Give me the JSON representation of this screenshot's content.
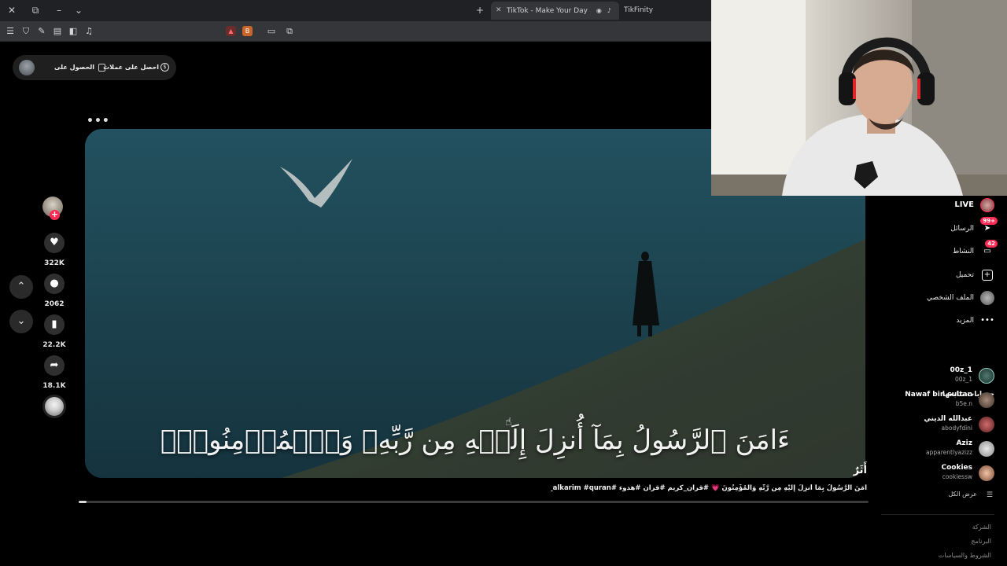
{
  "browser": {
    "tabs": [
      {
        "title": "TikTok - Make Your Day",
        "active": true
      },
      {
        "title": "TikFinity",
        "active": false
      }
    ],
    "new_tab": "+"
  },
  "page": {
    "top_pill": {
      "coins_label": "احصل على عملات",
      "app_label": "الحصول على الت..."
    },
    "more": "•••",
    "video": {
      "verse": "ءَامَنَ ٱلرَّسُولُ بِمَآ أُنزِلَ إِلَيۡهِ مِن رَّبِّهِۦ وَٱلۡمُؤۡمِنُونَۚ"
    },
    "actions": {
      "likes": "322K",
      "comments": "2062",
      "saves": "22.2K",
      "shares": "18.1K"
    },
    "caption": {
      "user": "أَثَرٌ",
      "desc": "آمَنَ الرَّسُولُ بِمَآ أُنزِلَ إِلَيْهِ مِن رَّبِّهِ وَالْمُؤْمِنُونَ 💗 #قران_كريم #قران #هدوء #quran_alkarim #quran",
      "progress": 0.01
    }
  },
  "sidebar": {
    "nav": [
      {
        "label": "LIVE",
        "icon": "live-icon"
      },
      {
        "label": "الرسائل",
        "icon": "messages-icon",
        "badge": "99+"
      },
      {
        "label": "النشاط",
        "icon": "activity-icon",
        "badge": "42"
      },
      {
        "label": "تحميل",
        "icon": "upload-icon"
      },
      {
        "label": "الملف الشخصي",
        "icon": "profile-icon"
      },
      {
        "label": "المزيد",
        "icon": "more-icon"
      }
    ],
    "following_title": "حسابات تتابعها",
    "accounts": [
      {
        "name": "00z_1",
        "handle": "00z_1"
      },
      {
        "name": "Nawaf bin sultan",
        "handle": "b5e.n"
      },
      {
        "name": "عبدالله الديني",
        "handle": "abodyfdini"
      },
      {
        "name": "Aziz",
        "handle": "apparentlyazizz"
      },
      {
        "name": "Cookies",
        "handle": "cookiessw"
      }
    ],
    "see_all": "عرض الكل",
    "footer": [
      "الشركة",
      "البرنامج",
      "الشروط والسياسات"
    ]
  },
  "colors": {
    "brand": "#fe2c55",
    "page_bg": "#000000",
    "chrome": "#35363a"
  }
}
